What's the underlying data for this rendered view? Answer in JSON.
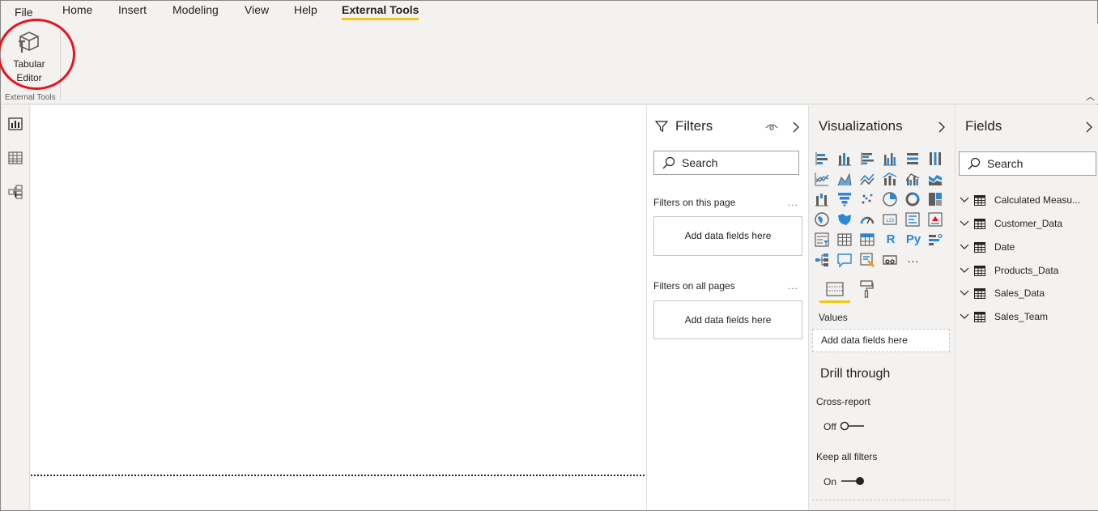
{
  "ribbon": {
    "tabs": [
      "File",
      "Home",
      "Insert",
      "Modeling",
      "View",
      "Help",
      "External Tools"
    ],
    "active_tab": "External Tools",
    "tabular_editor_line1": "Tabular",
    "tabular_editor_line2": "Editor",
    "group_label": "External Tools"
  },
  "filters": {
    "title": "Filters",
    "search_placeholder": "Search",
    "on_this_page": "Filters on this page",
    "on_all_pages": "Filters on all pages",
    "add_fields": "Add data fields here",
    "more": "..."
  },
  "visualizations": {
    "title": "Visualizations",
    "values_label": "Values",
    "values_drop": "Add data fields here",
    "drill_through": "Drill through",
    "cross_report": "Cross-report",
    "cross_report_state": "Off",
    "keep_all_filters": "Keep all filters",
    "keep_all_filters_state": "On",
    "r_visual": "R",
    "py_visual": "Py",
    "more_visuals": "..."
  },
  "fields": {
    "title": "Fields",
    "search_placeholder": "Search",
    "tables": [
      "Calculated Measu...",
      "Customer_Data",
      "Date",
      "Products_Data",
      "Sales_Data",
      "Sales_Team"
    ]
  },
  "colors": {
    "accent": "#f2c811",
    "highlight_circle": "#e8141c",
    "icon_blue": "#2b88d8",
    "icon_dark": "#605e5c"
  }
}
